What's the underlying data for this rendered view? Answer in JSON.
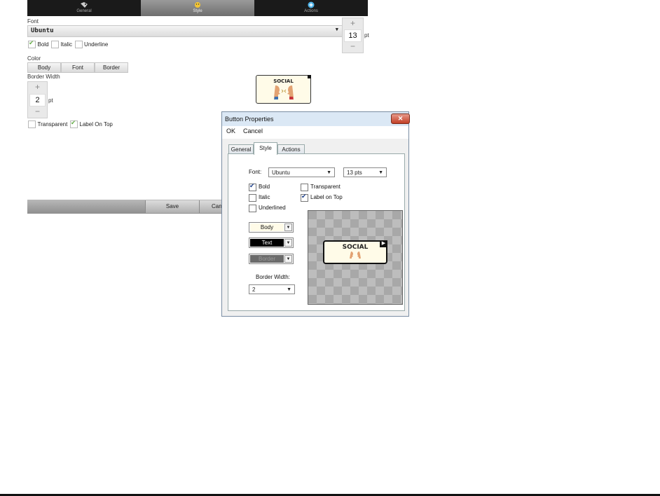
{
  "tabs": [
    {
      "label": "General",
      "icon": "tag-icon"
    },
    {
      "label": "Style",
      "icon": "smiley-icon"
    },
    {
      "label": "Actions",
      "icon": "plus-circle-icon"
    }
  ],
  "style_panel": {
    "font_label": "Font",
    "font_value": "Ubuntu",
    "font_size": "13",
    "font_size_unit": "pt",
    "bold_label": "Bold",
    "italic_label": "Italic",
    "underline_label": "Underline",
    "color_label": "Color",
    "color_buttons": [
      "Body",
      "Font",
      "Border"
    ],
    "border_width_label": "Border Width",
    "border_width_value": "2",
    "border_width_unit": "pt",
    "transparent_label": "Transparent",
    "label_on_top_label": "Label On Top",
    "save_label": "Save",
    "cancel_label": "Cancel",
    "bold_checked": true,
    "italic_checked": false,
    "underline_checked": false,
    "transparent_checked": false,
    "label_on_top_checked": true
  },
  "symbol_tile": {
    "label": "SOCIAL"
  },
  "dialog": {
    "title": "Button Properties",
    "menu": [
      "OK",
      "Cancel"
    ],
    "close_glyph": "✕",
    "tabs": [
      "General",
      "Style",
      "Actions"
    ],
    "font_label": "Font:",
    "font_value": "Ubuntu",
    "font_size_value": "13 pts",
    "bold_label": "Bold",
    "italic_label": "Italic",
    "underlined_label": "Underlined",
    "transparent_label": "Transparent",
    "label_on_top_label": "Label on Top",
    "body_label": "Body",
    "text_label": "Text",
    "border_label": "Border",
    "border_width_label": "Border Width:",
    "border_width_value": "2",
    "preview_label": "SOCIAL",
    "colors": {
      "body": "#fffbe8",
      "text": "#000000",
      "border": "#6b6b6b"
    }
  }
}
